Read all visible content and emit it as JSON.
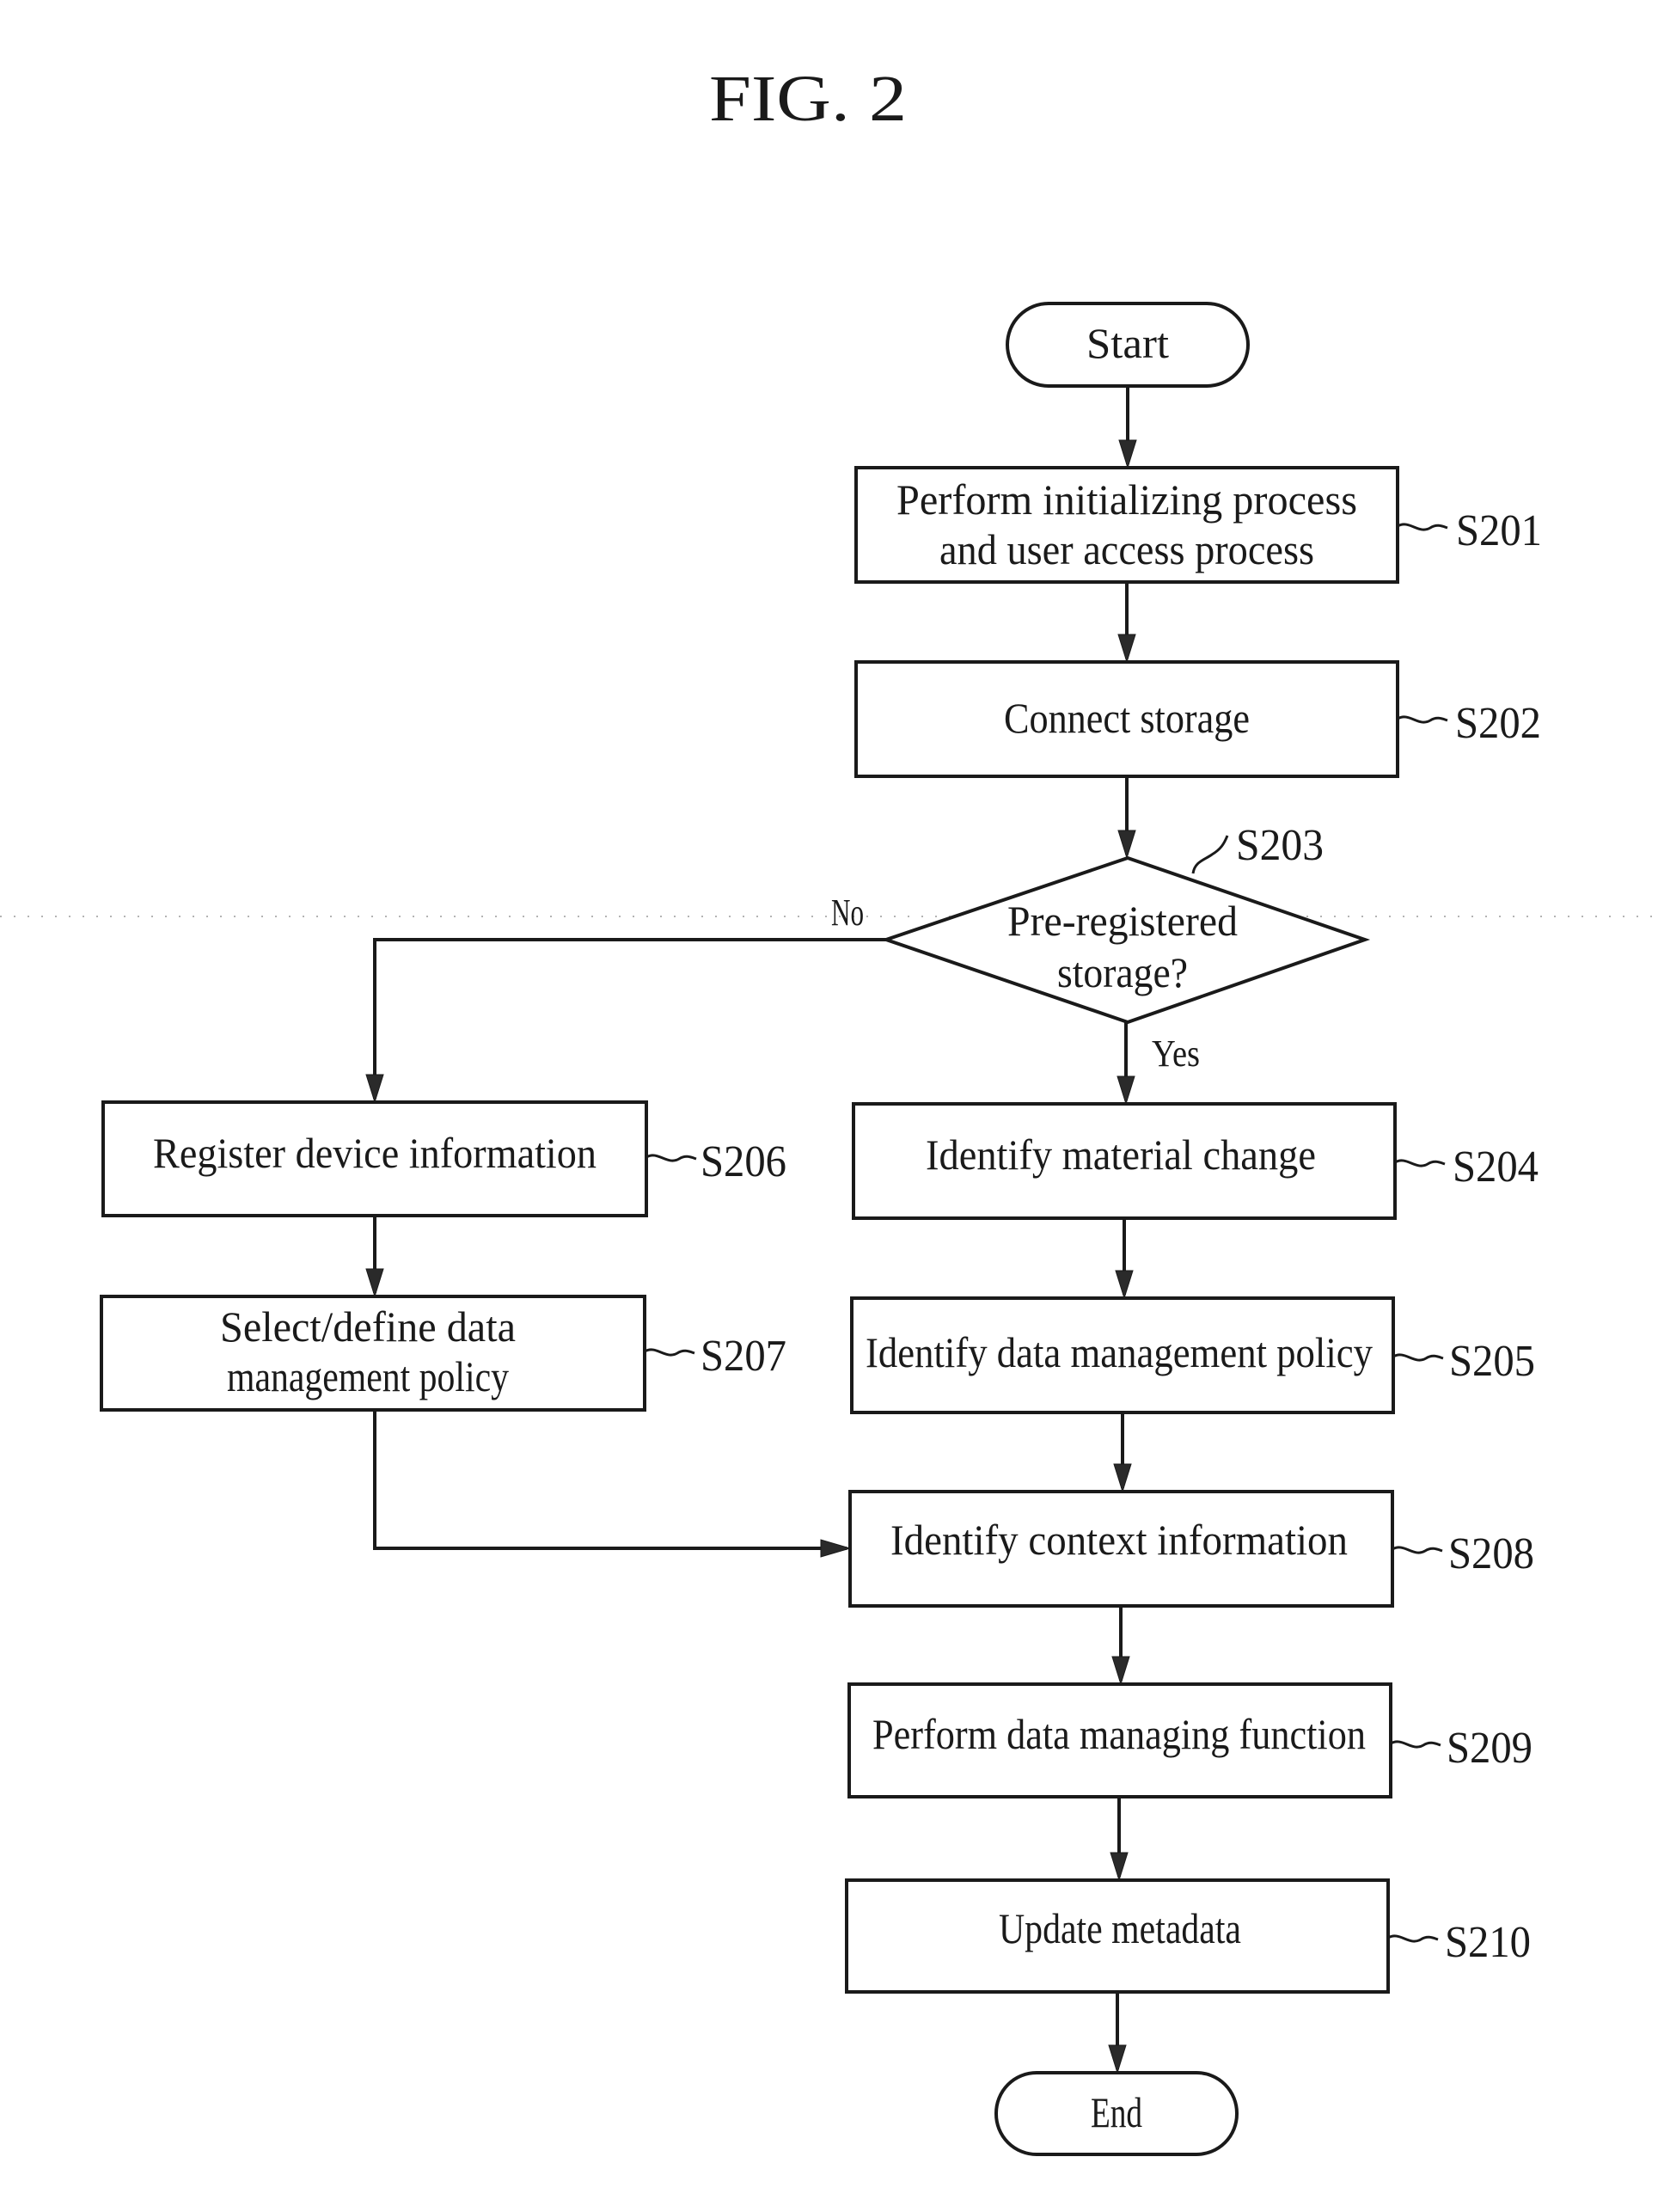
{
  "figure": {
    "title": "FIG. 2"
  },
  "terminals": {
    "start": "Start",
    "end": "End"
  },
  "steps": {
    "s201": {
      "lines": [
        "Perform initializing process",
        "and user access process"
      ],
      "ref": "S201"
    },
    "s202": {
      "lines": [
        "Connect storage"
      ],
      "ref": "S202"
    },
    "s203": {
      "lines": [
        "Pre-registered",
        "storage?"
      ],
      "ref": "S203"
    },
    "s204": {
      "lines": [
        "Identify material change"
      ],
      "ref": "S204"
    },
    "s205": {
      "lines": [
        "Identify data management policy"
      ],
      "ref": "S205"
    },
    "s206": {
      "lines": [
        "Register device information"
      ],
      "ref": "S206"
    },
    "s207": {
      "lines": [
        "Select/define data",
        "management policy"
      ],
      "ref": "S207"
    },
    "s208": {
      "lines": [
        "Identify context information"
      ],
      "ref": "S208"
    },
    "s209": {
      "lines": [
        "Perform data managing function"
      ],
      "ref": "S209"
    },
    "s210": {
      "lines": [
        "Update metadata"
      ],
      "ref": "S210"
    }
  },
  "branches": {
    "no": "No",
    "yes": "Yes"
  },
  "flow": [
    [
      "Start",
      "S201"
    ],
    [
      "S201",
      "S202"
    ],
    [
      "S202",
      "S203"
    ],
    [
      "S203",
      "S204",
      "Yes"
    ],
    [
      "S203",
      "S206",
      "No"
    ],
    [
      "S204",
      "S205"
    ],
    [
      "S205",
      "S208"
    ],
    [
      "S206",
      "S207"
    ],
    [
      "S207",
      "S208"
    ],
    [
      "S208",
      "S209"
    ],
    [
      "S209",
      "S210"
    ],
    [
      "S210",
      "End"
    ]
  ]
}
